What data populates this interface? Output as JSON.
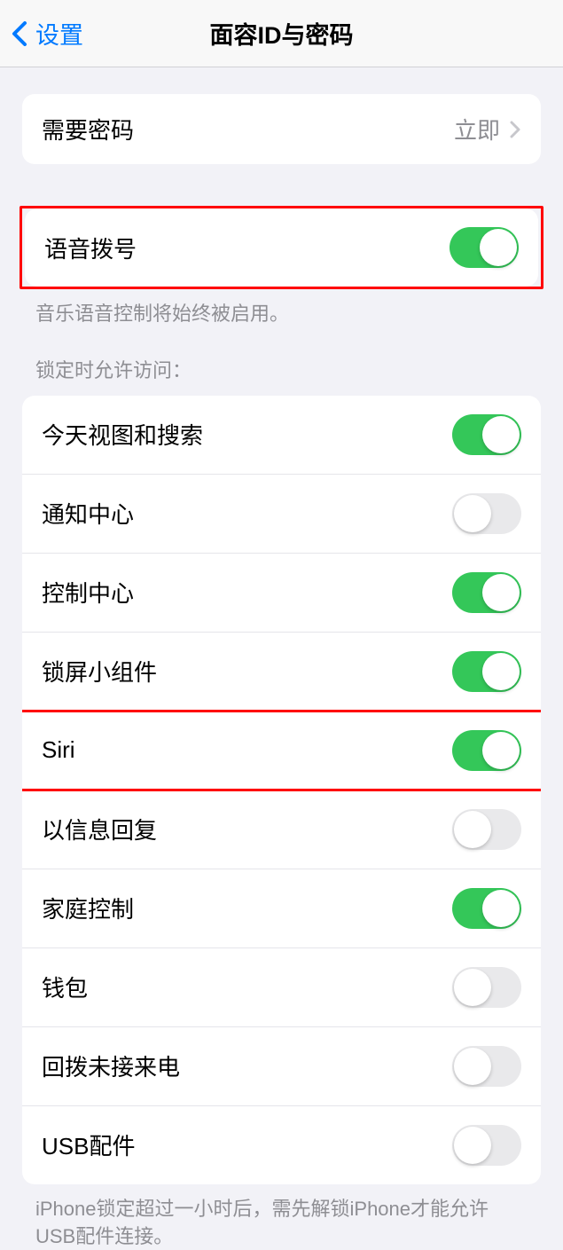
{
  "header": {
    "back_label": "设置",
    "title": "面容ID与密码"
  },
  "group_passcode": {
    "require_passcode_label": "需要密码",
    "require_passcode_value": "立即"
  },
  "group_voice": {
    "voice_dial_label": "语音拨号",
    "voice_dial_on": true,
    "voice_dial_footer": "音乐语音控制将始终被启用。"
  },
  "section_locked_header": "锁定时允许访问：",
  "group_locked": {
    "items": [
      {
        "label": "今天视图和搜索",
        "on": true
      },
      {
        "label": "通知中心",
        "on": false
      },
      {
        "label": "控制中心",
        "on": true
      },
      {
        "label": "锁屏小组件",
        "on": true
      },
      {
        "label": "Siri",
        "on": true
      },
      {
        "label": "以信息回复",
        "on": false
      },
      {
        "label": "家庭控制",
        "on": true
      },
      {
        "label": "钱包",
        "on": false
      },
      {
        "label": "回拨未接来电",
        "on": false
      },
      {
        "label": "USB配件",
        "on": false
      }
    ],
    "footer": "iPhone锁定超过一小时后，需先解锁iPhone才能允许USB配件连接。"
  }
}
